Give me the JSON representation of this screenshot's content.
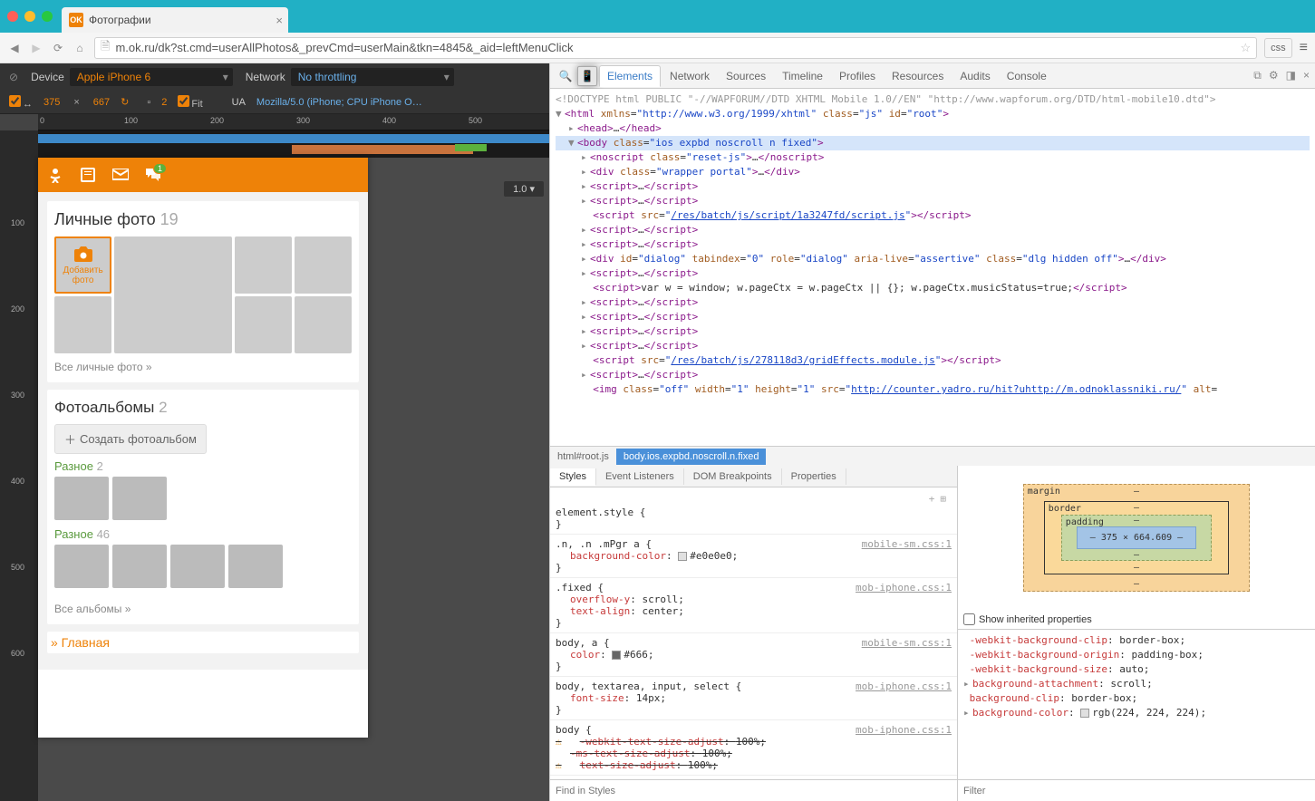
{
  "browser": {
    "tab_title": "Фотографии",
    "url": "m.ok.ru/dk?st.cmd=userAllPhotos&_prevCmd=userMain&tkn=4845&_aid=leftMenuClick",
    "css_ext": "css",
    "star_title": "Bookmark"
  },
  "deviceToolbar": {
    "device_label": "Device",
    "device_value": "Apple iPhone 6",
    "network_label": "Network",
    "network_value": "No throttling",
    "width": "375",
    "height": "667",
    "screen_count": "2",
    "fit_label": "Fit",
    "ua_label": "UA",
    "ua_value": "Mozilla/5.0 (iPhone; CPU iPhone O…",
    "zoom": "1.0",
    "ruler_ticks_h": [
      "0",
      "100",
      "200",
      "300",
      "400",
      "500"
    ],
    "ruler_ticks_v": [
      "100",
      "200",
      "300",
      "400",
      "500",
      "600"
    ]
  },
  "okApp": {
    "notif_badge": "1",
    "personal_photos": {
      "title": "Личные фото",
      "count": "19",
      "add_label": "Добавить фото",
      "all_link": "Все личные фото »"
    },
    "albums": {
      "title": "Фотоальбомы",
      "count": "2",
      "create_btn": "Создать фотоальбом",
      "items": [
        {
          "name": "Разное",
          "count": "2"
        },
        {
          "name": "Разное",
          "count": "46"
        }
      ],
      "all_link": "Все альбомы »"
    },
    "home_link": "» Главная"
  },
  "devtools": {
    "tabs": [
      "Elements",
      "Network",
      "Sources",
      "Timeline",
      "Profiles",
      "Resources",
      "Audits",
      "Console"
    ],
    "active_tab": "Elements",
    "doctype": "<!DOCTYPE html PUBLIC \"-//WAPFORUM//DTD XHTML Mobile 1.0//EN\" \"http://www.wapforum.org/DTD/html-mobile10.dtd\">",
    "dom": {
      "html_attrs": {
        "xmlns": "http://www.w3.org/1999/xhtml",
        "class": "js",
        "id": "root"
      },
      "body_class": "ios expbd noscroll n fixed",
      "noscript_class": "reset-js",
      "wrapper_class": "wrapper portal",
      "script_src1": "/res/batch/js/script/1a3247fd/script.js",
      "dialog_attrs": "id=\"dialog\" tabindex=\"0\" role=\"dialog\" aria-live=\"assertive\" class=\"dlg hidden off\"",
      "inline_script": "var w = window; w.pageCtx = w.pageCtx || {}; w.pageCtx.musicStatus=true;",
      "script_src2": "/res/batch/js/278118d3/gridEffects.module.js",
      "img_attrs": "class=\"off\" width=\"1\" height=\"1\" src=\"",
      "img_src": "http://counter.yadro.ru/hit?uhttp://m.odnoklassniki.ru/",
      "img_tail": "\" alt="
    },
    "crumbs": [
      "html#root.js",
      "body.ios.expbd.noscroll.n.fixed"
    ],
    "styles_tabs": [
      "Styles",
      "Event Listeners",
      "DOM Breakpoints",
      "Properties"
    ],
    "rules": [
      {
        "selector": "element.style {",
        "src": "",
        "props": []
      },
      {
        "selector": ".n, .n .mPgr a {",
        "src": "mobile-sm.css:1",
        "props": [
          {
            "k": "background-color",
            "v": "#e0e0e0",
            "sw": "#e0e0e0"
          }
        ]
      },
      {
        "selector": ".fixed {",
        "src": "mob-iphone.css:1",
        "props": [
          {
            "k": "overflow-y",
            "v": "scroll"
          },
          {
            "k": "text-align",
            "v": "center"
          }
        ]
      },
      {
        "selector": "body, a {",
        "src": "mobile-sm.css:1",
        "props": [
          {
            "k": "color",
            "v": "#666",
            "sw": "#666"
          }
        ]
      },
      {
        "selector": "body, textarea, input, select {",
        "src": "mob-iphone.css:1",
        "props": [
          {
            "k": "font-size",
            "v": "14px"
          }
        ]
      },
      {
        "selector": "body {",
        "src": "mob-iphone.css:1",
        "props": [
          {
            "k": "-webkit-text-size-adjust",
            "v": "100%",
            "warn": true,
            "strike": true
          },
          {
            "k": "-ms-text-size-adjust",
            "v": "100%",
            "strike": true
          },
          {
            "k": "text-size-adjust",
            "v": "100%",
            "warn": true,
            "strike": true
          }
        ]
      }
    ],
    "find_placeholder": "Find in Styles",
    "filter_placeholder": "Filter",
    "boxmodel": {
      "margin": "margin",
      "border": "border",
      "padding": "padding",
      "content": "375 × 664.609",
      "dash": "–"
    },
    "computed": {
      "show_inherited": "Show inherited properties",
      "props": [
        {
          "k": "-webkit-background-clip",
          "v": "border-box"
        },
        {
          "k": "-webkit-background-origin",
          "v": "padding-box"
        },
        {
          "k": "-webkit-background-size",
          "v": "auto"
        },
        {
          "k": "background-attachment",
          "v": "scroll",
          "tog": "▸"
        },
        {
          "k": "background-clip",
          "v": "border-box"
        },
        {
          "k": "background-color",
          "v": "rgb(224, 224, 224)",
          "tog": "▸",
          "sw": "rgb(224,224,224)"
        }
      ]
    }
  }
}
